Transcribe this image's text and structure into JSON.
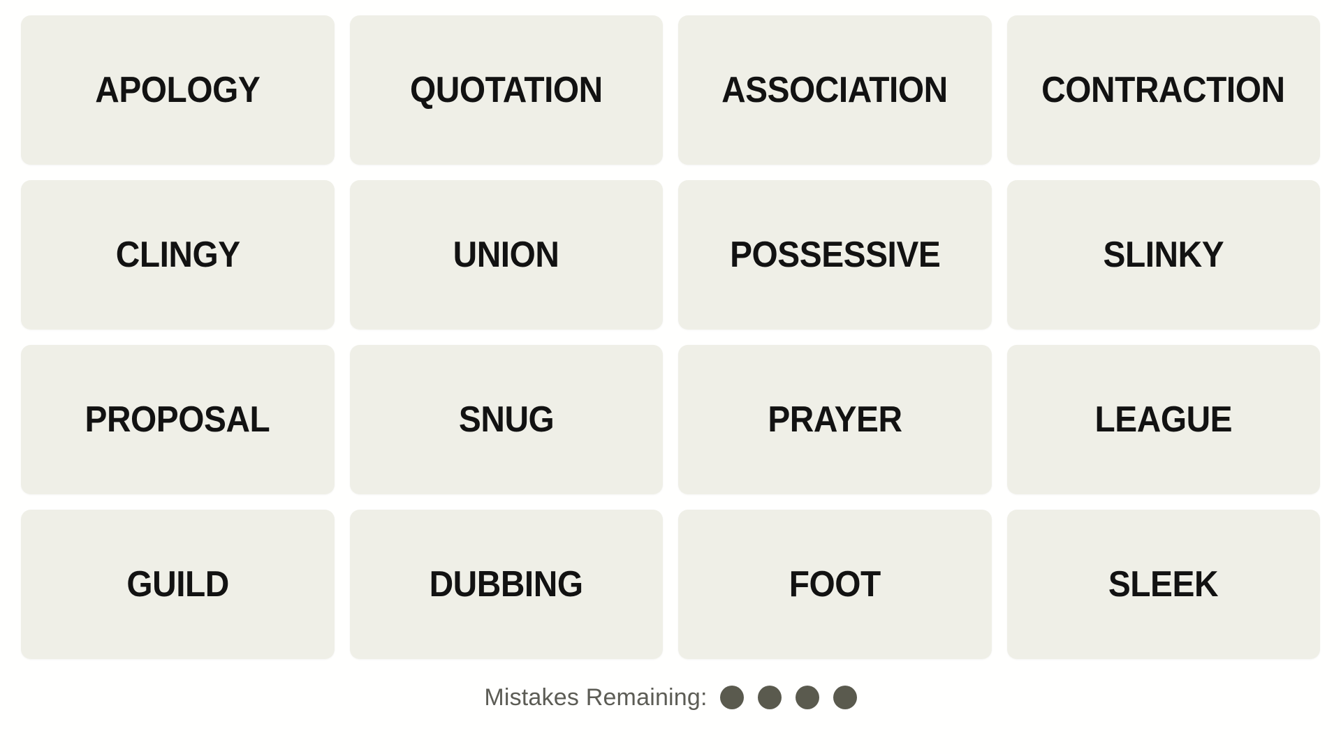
{
  "board": {
    "rows": 4,
    "columns": 4,
    "tile_color": "#EFEFE7",
    "background_color": "#FFFFFE",
    "text_color": "#121212",
    "tiles": [
      {
        "word": "APOLOGY",
        "row": 1,
        "col": 1
      },
      {
        "word": "QUOTATION",
        "row": 1,
        "col": 2
      },
      {
        "word": "ASSOCIATION",
        "row": 1,
        "col": 3
      },
      {
        "word": "CONTRACTION",
        "row": 1,
        "col": 4
      },
      {
        "word": "CLINGY",
        "row": 2,
        "col": 1
      },
      {
        "word": "UNION",
        "row": 2,
        "col": 2
      },
      {
        "word": "POSSESSIVE",
        "row": 2,
        "col": 3
      },
      {
        "word": "SLINKY",
        "row": 2,
        "col": 4
      },
      {
        "word": "PROPOSAL",
        "row": 3,
        "col": 1
      },
      {
        "word": "SNUG",
        "row": 3,
        "col": 2
      },
      {
        "word": "PRAYER",
        "row": 3,
        "col": 3
      },
      {
        "word": "LEAGUE",
        "row": 3,
        "col": 4
      },
      {
        "word": "GUILD",
        "row": 4,
        "col": 1
      },
      {
        "word": "DUBBING",
        "row": 4,
        "col": 2
      },
      {
        "word": "FOOT",
        "row": 4,
        "col": 3
      },
      {
        "word": "SLEEK",
        "row": 4,
        "col": 4
      }
    ]
  },
  "footer": {
    "mistakes_label": "Mistakes Remaining:",
    "mistakes_remaining": 4,
    "dot_color": "#5A5A4E",
    "label_color": "#5C5C55"
  }
}
